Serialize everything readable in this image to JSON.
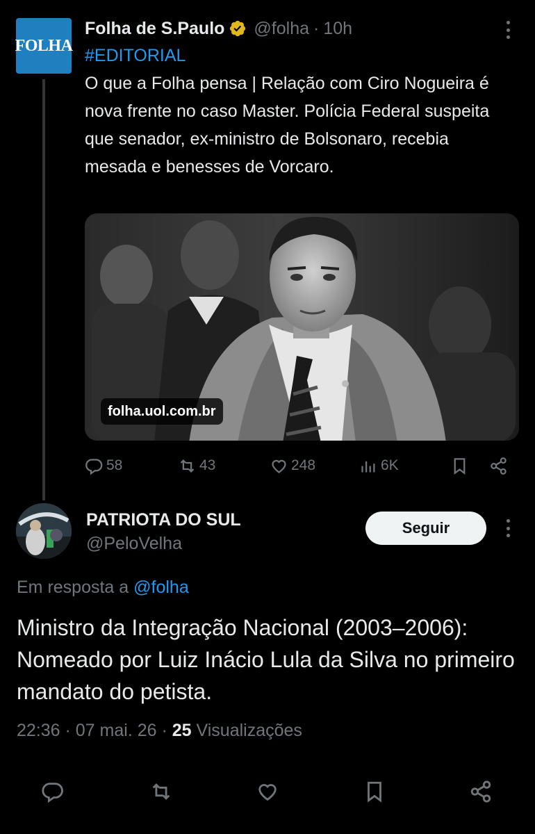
{
  "original_tweet": {
    "author": {
      "name": "Folha de S.Paulo",
      "handle": "@folha",
      "avatar_text": "FOLHA",
      "verified": true
    },
    "separator": "·",
    "time": "10h",
    "hashtag": "#EDITORIAL",
    "text": "O que a Folha pensa | Relação com Ciro Nogueira é nova frente no caso Master. Polícia Federal suspeita que senador, ex-ministro de Bolsonaro, recebia mesada e benesses de Vorcaro.",
    "media": {
      "link_card_domain": "folha.uol.com.br"
    },
    "actions": {
      "replies": "58",
      "reposts": "43",
      "likes": "248",
      "views": "6K"
    }
  },
  "reply": {
    "author": {
      "name": "PATRIOTA DO SUL",
      "handle": "@PeloVelha"
    },
    "follow_label": "Seguir",
    "reply_to_prefix": "Em resposta a",
    "reply_to_mention": "@folha",
    "text": "Ministro da Integração Nacional (2003–2006): Nomeado por Luiz Inácio Lula da Silva no primeiro mandato do petista.",
    "timestamp": "22:36 · 07 mai. 26 ·",
    "views_count": "25",
    "views_label": "Visualizações"
  },
  "colors": {
    "background": "#000000",
    "text_primary": "#e7e9ea",
    "text_secondary": "#71767b",
    "link": "#1d9bf0",
    "verified_badge": "#e2b719",
    "follow_button_bg": "#eff3f4"
  },
  "icons": [
    "reply-icon",
    "repost-icon",
    "like-icon",
    "views-icon",
    "bookmark-icon",
    "share-icon",
    "more-icon",
    "verified-badge-icon"
  ]
}
